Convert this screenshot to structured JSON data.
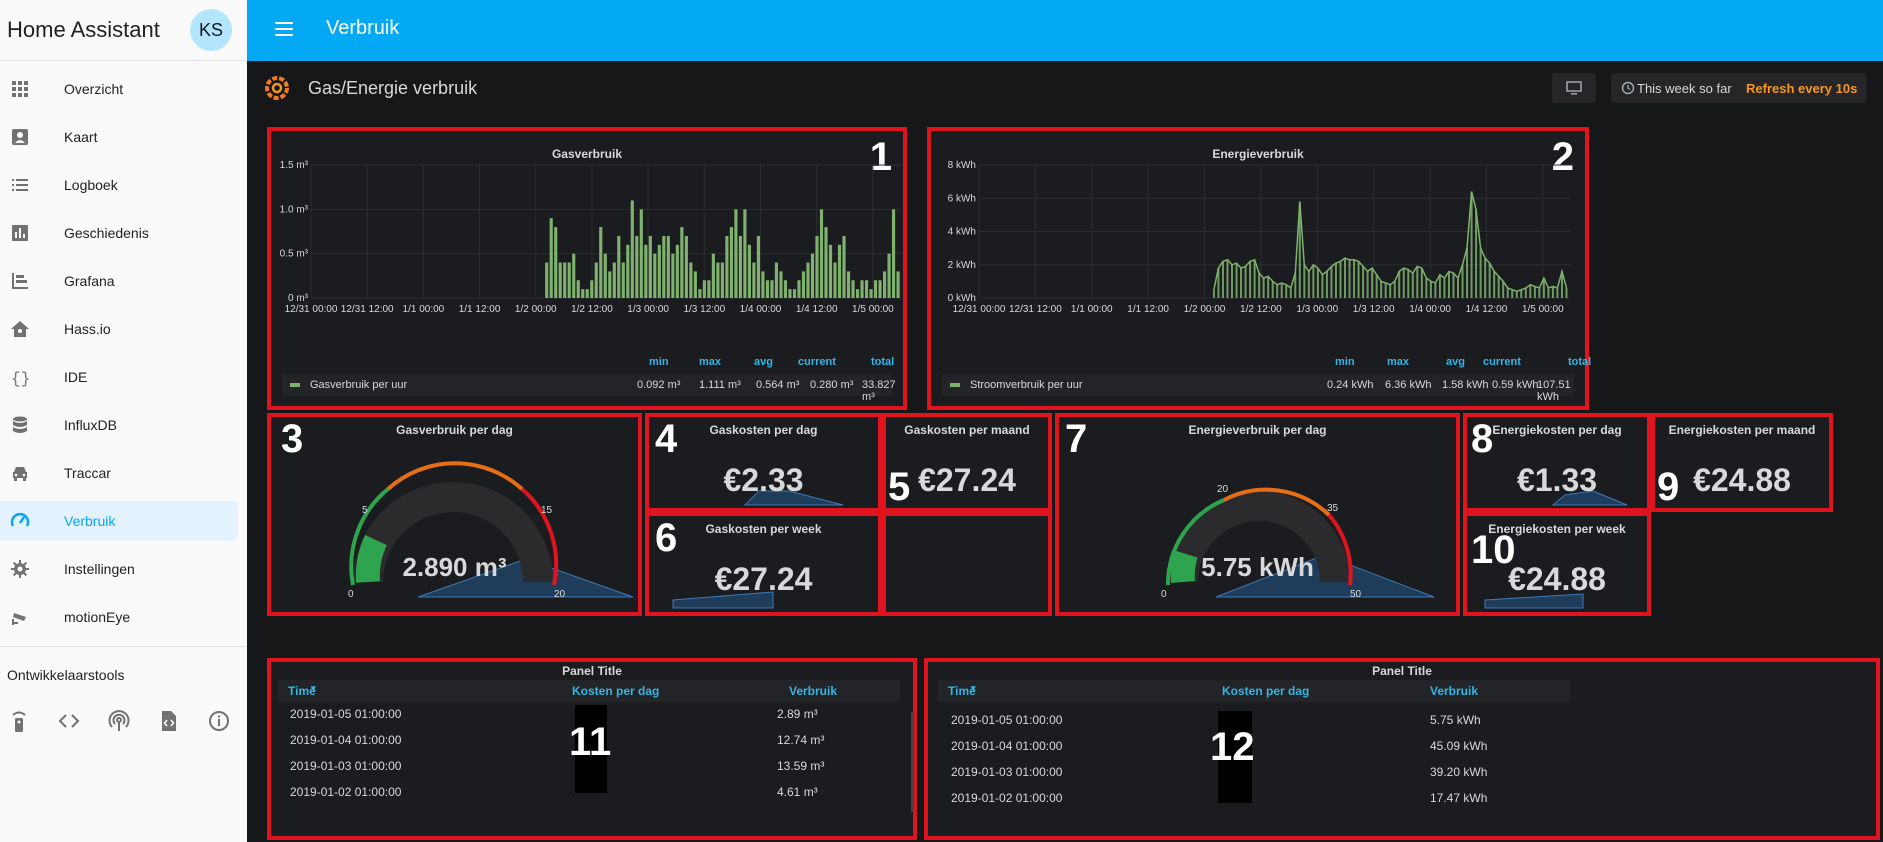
{
  "sidebar": {
    "title": "Home Assistant",
    "avatar": "KS",
    "items": [
      {
        "label": "Overzicht",
        "icon": "grid-icon"
      },
      {
        "label": "Kaart",
        "icon": "account-box-icon"
      },
      {
        "label": "Logboek",
        "icon": "list-icon"
      },
      {
        "label": "Geschiedenis",
        "icon": "chart-bar-icon"
      },
      {
        "label": "Grafana",
        "icon": "chart-timeline-icon"
      },
      {
        "label": "Hass.io",
        "icon": "home-assistant-icon"
      },
      {
        "label": "IDE",
        "icon": "code-braces-icon"
      },
      {
        "label": "InfluxDB",
        "icon": "database-icon"
      },
      {
        "label": "Traccar",
        "icon": "car-icon"
      },
      {
        "label": "Verbruik",
        "icon": "speedometer-icon",
        "active": true
      },
      {
        "label": "Instellingen",
        "icon": "gear-icon"
      },
      {
        "label": "motionEye",
        "icon": "cctv-icon"
      }
    ],
    "devtools_label": "Ontwikkelaarstools",
    "devtools_icons": [
      "remote-icon",
      "code-tags-icon",
      "access-point-icon",
      "file-xml-icon",
      "info-icon"
    ]
  },
  "topbar": {
    "title": "Verbruik"
  },
  "dashboard": {
    "title": "Gas/Energie verbruik",
    "time_range": "This week so far",
    "refresh": "Refresh every 10s"
  },
  "panels": {
    "gas_graph": {
      "title": "Gasverbruik",
      "number": "1",
      "y_ticks": [
        "1.5 m³",
        "1.0 m³",
        "0.5 m³",
        "0 m³"
      ],
      "x_ticks": [
        "12/31 00:00",
        "12/31 12:00",
        "1/1 00:00",
        "1/1 12:00",
        "1/2 00:00",
        "1/2 12:00",
        "1/3 00:00",
        "1/3 12:00",
        "1/4 00:00",
        "1/4 12:00",
        "1/5 00:00"
      ],
      "legend_headers": [
        "min",
        "max",
        "avg",
        "current",
        "total"
      ],
      "series_name": "Gasverbruik per uur",
      "legend_values": [
        "0.092 m³",
        "1.111 m³",
        "0.564 m³",
        "0.280 m³",
        "33.827 m³"
      ]
    },
    "energy_graph": {
      "title": "Energieverbruik",
      "number": "2",
      "y_ticks": [
        "8 kWh",
        "6 kWh",
        "4 kWh",
        "2 kWh",
        "0 kWh"
      ],
      "x_ticks": [
        "12/31 00:00",
        "12/31 12:00",
        "1/1 00:00",
        "1/1 12:00",
        "1/2 00:00",
        "1/2 12:00",
        "1/3 00:00",
        "1/3 12:00",
        "1/4 00:00",
        "1/4 12:00",
        "1/5 00:00"
      ],
      "legend_headers": [
        "min",
        "max",
        "avg",
        "current",
        "total"
      ],
      "series_name": "Stroomverbruik per uur",
      "legend_values": [
        "0.24 kWh",
        "6.36 kWh",
        "1.58 kWh",
        "0.59 kWh",
        "107.51 kWh"
      ]
    },
    "gas_day_gauge": {
      "title": "Gasverbruik per dag",
      "number": "3",
      "value": "2.890 m³",
      "ticks": [
        "0",
        "5",
        "15",
        "20"
      ]
    },
    "gas_cost_day": {
      "title": "Gaskosten per dag",
      "number": "4",
      "value": "€2.33"
    },
    "gas_cost_month": {
      "title": "Gaskosten per maand",
      "number": "5",
      "value": "€27.24"
    },
    "gas_cost_week": {
      "title": "Gaskosten per week",
      "number": "6",
      "value": "€27.24"
    },
    "energy_day_gauge": {
      "title": "Energieverbruik per dag",
      "number": "7",
      "value": "5.75 kWh",
      "ticks": [
        "0",
        "20",
        "35",
        "50"
      ]
    },
    "energy_cost_day": {
      "title": "Energiekosten per dag",
      "number": "8",
      "value": "€1.33"
    },
    "energy_cost_month": {
      "title": "Energiekosten per maand",
      "number": "9",
      "value": "€24.88"
    },
    "energy_cost_week": {
      "title": "Energiekosten per week",
      "number": "10",
      "value": "€24.88"
    },
    "gas_table": {
      "title": "Panel Title",
      "number": "11",
      "headers": [
        "Time",
        "Kosten per dag",
        "Verbruik"
      ],
      "rows": [
        [
          "2019-01-05 01:00:00",
          "2.89 m³"
        ],
        [
          "2019-01-04 01:00:00",
          "12.74 m³"
        ],
        [
          "2019-01-03 01:00:00",
          "13.59 m³"
        ],
        [
          "2019-01-02 01:00:00",
          "4.61 m³"
        ]
      ]
    },
    "energy_table": {
      "title": "Panel Title",
      "number": "12",
      "headers": [
        "Time",
        "Kosten per dag",
        "Verbruik"
      ],
      "rows": [
        [
          "2019-01-05 01:00:00",
          "5.75 kWh"
        ],
        [
          "2019-01-04 01:00:00",
          "45.09 kWh"
        ],
        [
          "2019-01-03 01:00:00",
          "39.20 kWh"
        ],
        [
          "2019-01-02 01:00:00",
          "17.47 kWh"
        ]
      ]
    }
  },
  "colors": {
    "accent": "#03a9f4",
    "series_green": "#7eb26d",
    "annotation_red": "#e0141e",
    "refresh_orange": "#f79520"
  },
  "chart_data": [
    {
      "type": "bar",
      "title": "Gasverbruik",
      "ylim": [
        0,
        1.5
      ],
      "x_range": [
        "12/31 00:00",
        "1/5 06:00"
      ],
      "series": [
        {
          "name": "Gasverbruik per uur",
          "values": [
            0.4,
            0.9,
            0.8,
            0.4,
            0.4,
            0.4,
            0.5,
            0.2,
            0.1,
            0.1,
            0.2,
            0.4,
            0.8,
            0.5,
            0.3,
            0.4,
            0.7,
            0.4,
            0.6,
            1.1,
            0.7,
            1.0,
            0.6,
            0.7,
            0.5,
            0.6,
            0.7,
            0.7,
            0.5,
            0.6,
            0.8,
            0.7,
            0.4,
            0.3,
            0.1,
            0.2,
            0.2,
            0.5,
            0.4,
            0.4,
            0.7,
            0.8,
            1.0,
            0.7,
            1.0,
            0.6,
            0.4,
            0.7,
            0.3,
            0.2,
            0.2,
            0.4,
            0.3,
            0.2,
            0.1,
            0.1,
            0.2,
            0.3,
            0.4,
            0.5,
            0.7,
            1.0,
            0.8,
            0.6,
            0.4,
            0.6,
            0.7,
            0.3,
            0.2,
            0.1,
            0.2,
            0.2,
            0.1,
            0.2,
            0.2,
            0.3,
            0.5,
            1.0,
            0.3
          ]
        }
      ]
    },
    {
      "type": "area",
      "title": "Energieverbruik",
      "ylim": [
        0,
        8
      ],
      "x_range": [
        "12/31 00:00",
        "1/5 06:00"
      ],
      "series": [
        {
          "name": "Stroomverbruik per uur",
          "values": [
            0.5,
            1.8,
            2.2,
            2.3,
            2.0,
            2.1,
            1.8,
            1.9,
            2.2,
            2.3,
            1.5,
            1.2,
            1.3,
            1.0,
            0.8,
            0.9,
            0.8,
            0.6,
            1.5,
            5.8,
            2.0,
            1.6,
            2.0,
            1.8,
            1.4,
            1.6,
            1.9,
            2.1,
            2.2,
            2.4,
            2.3,
            2.3,
            2.2,
            1.9,
            1.6,
            1.8,
            1.4,
            1.0,
            0.9,
            0.8,
            1.0,
            1.6,
            1.8,
            1.7,
            1.5,
            1.9,
            1.8,
            1.2,
            1.0,
            0.9,
            1.4,
            1.2,
            1.6,
            1.5,
            1.2,
            2.0,
            3.0,
            6.4,
            5.3,
            3.0,
            2.4,
            2.1,
            1.6,
            1.3,
            1.0,
            0.6,
            0.5,
            0.4,
            0.5,
            0.6,
            0.8,
            0.7,
            0.6,
            1.2,
            0.6,
            0.7,
            0.6,
            1.6,
            0.6
          ]
        }
      ]
    }
  ]
}
